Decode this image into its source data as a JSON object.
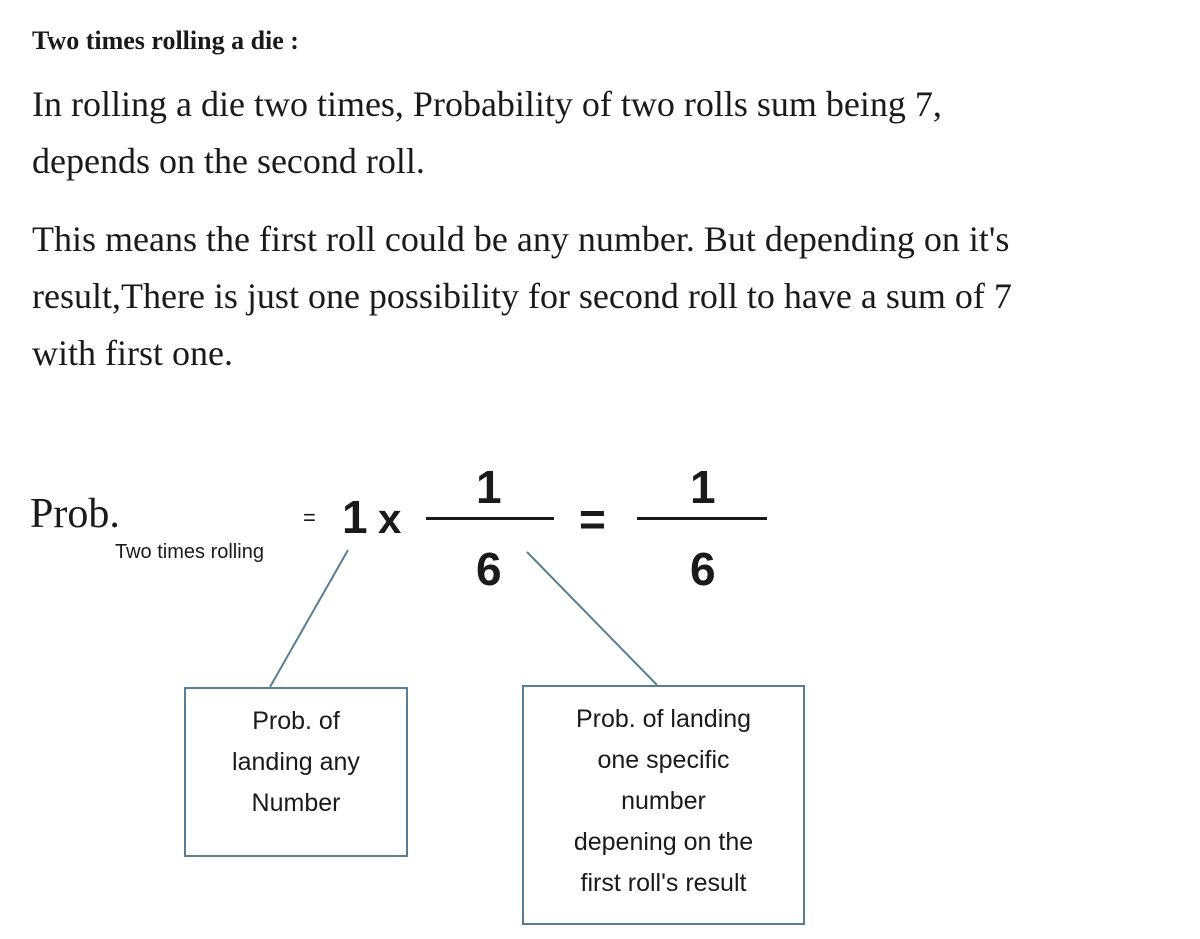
{
  "heading": "Two times rolling a die :",
  "paragraph1": {
    "line1": "In rolling a die two times, Probability of two rolls sum being 7,",
    "line2": "depends on the second roll."
  },
  "paragraph2": {
    "line1": "This means the first roll could be any number. But depending on it's",
    "line2": "result,There is just one possibility for second roll to have a sum of 7",
    "line3": "with first one."
  },
  "formula": {
    "prob_label": "Prob.",
    "subscript": "Two times rolling",
    "equals_small": "=",
    "first_factor": "1",
    "times": "x",
    "frac1_numerator": "1",
    "frac1_denominator": "6",
    "equals": "=",
    "frac2_numerator": "1",
    "frac2_denominator": "6"
  },
  "callouts": {
    "left": {
      "line1": "Prob. of",
      "line2": "landing any",
      "line3": "Number"
    },
    "right": {
      "line1": "Prob. of landing",
      "line2": "one specific",
      "line3": "number",
      "line4": "depening on the",
      "line5": "first roll's result"
    }
  },
  "colors": {
    "connector": "#5a7d96",
    "text": "#1a1a1a"
  }
}
